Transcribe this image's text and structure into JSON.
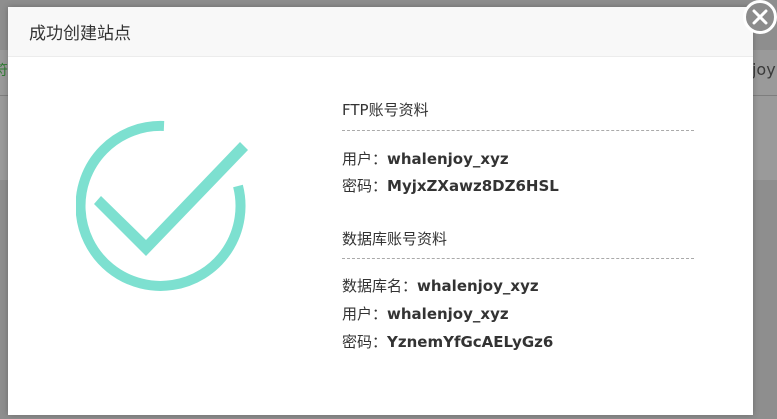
{
  "background": {
    "left_fragment": "符",
    "right_fragment": "enjoy"
  },
  "modal": {
    "title": "成功创建站点",
    "close_icon": "close-icon",
    "success_icon": "check-circle-icon",
    "accent_color": "#7de0d0"
  },
  "ftp": {
    "title": "FTP账号资料",
    "user_label": "用户：",
    "user_value": "whalenjoy_xyz",
    "password_label": "密码：",
    "password_value": "MyjxZXawz8DZ6HSL"
  },
  "database": {
    "title": "数据库账号资料",
    "name_label": "数据库名：",
    "name_value": "whalenjoy_xyz",
    "user_label": "用户：",
    "user_value": "whalenjoy_xyz",
    "password_label": "密码：",
    "password_value": "YznemYfGcAELyGz6"
  }
}
